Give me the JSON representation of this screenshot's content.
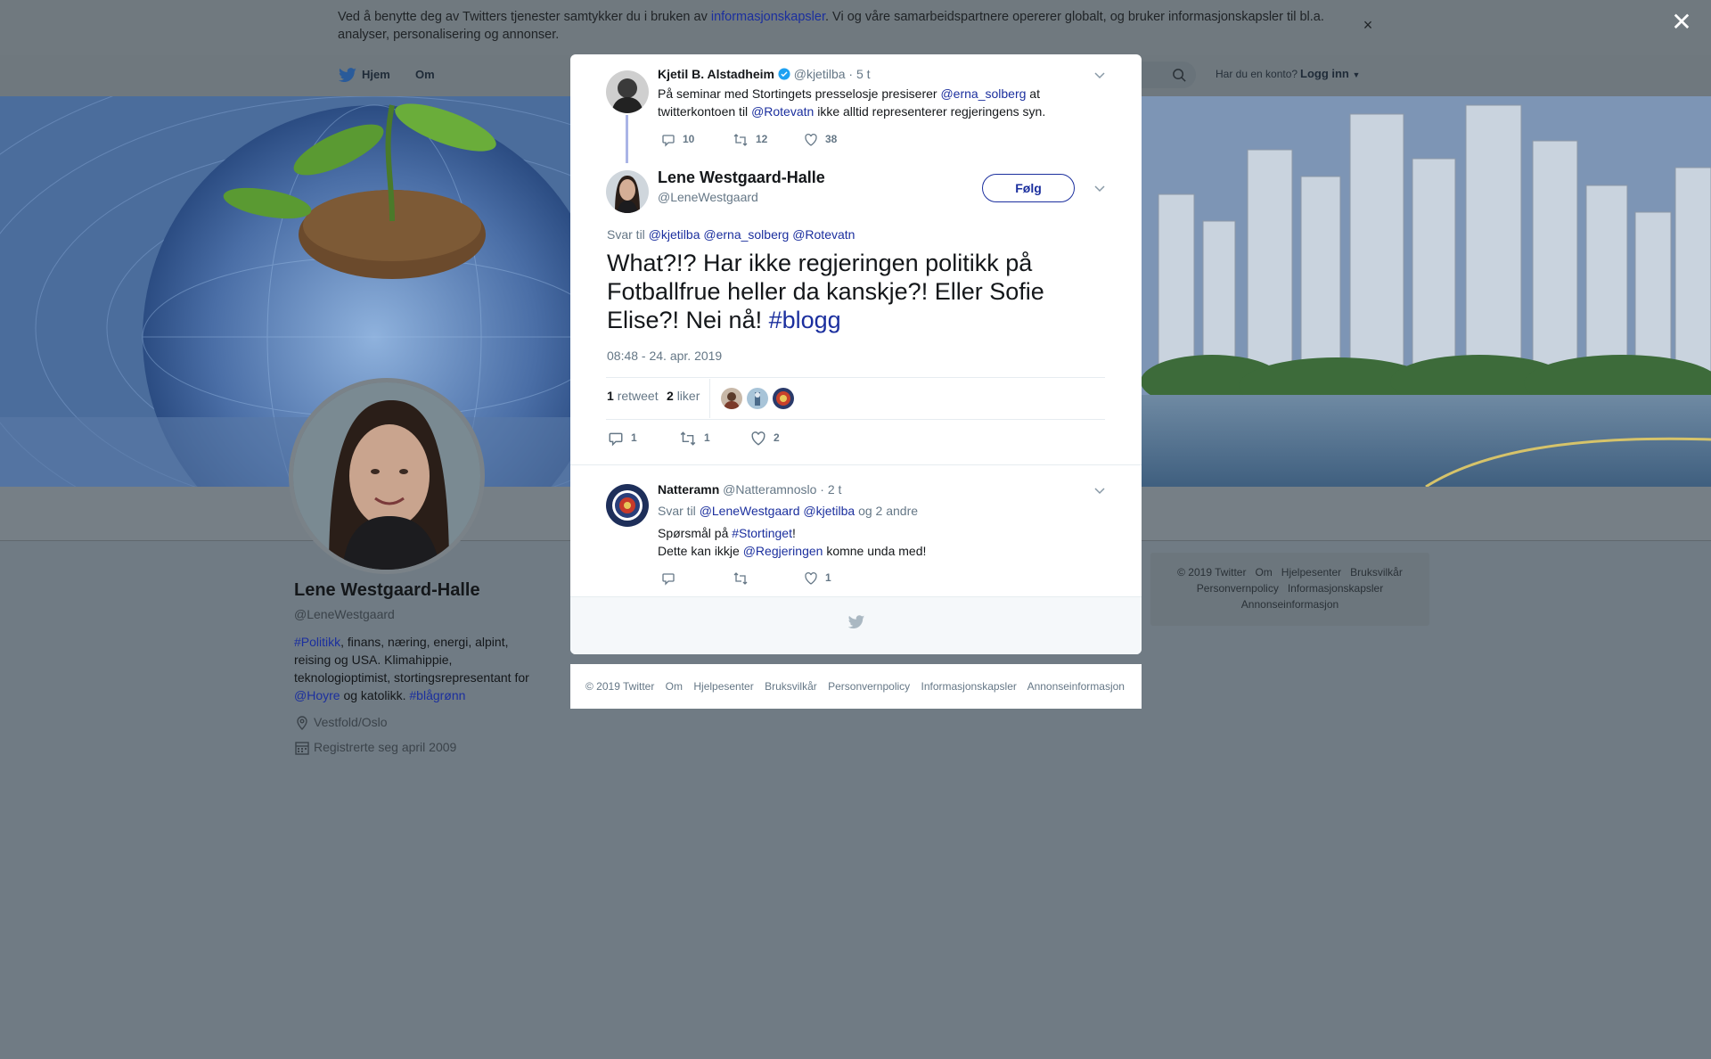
{
  "cookie": {
    "text_before": "Ved å benytte deg av Twitters tjenester samtykker du i bruken av ",
    "link": "informasjonskapsler",
    "text_after": ". Vi og våre samarbeidspartnere opererer globalt, og bruker informasjonskapsler til bl.a. analyser, personalisering og annonser.",
    "close": "×"
  },
  "overlay_close": "✕",
  "nav": {
    "home": "Hjem",
    "about": "Om",
    "login_question": "Har du en konto?",
    "login": "Logg inn"
  },
  "profile": {
    "name": "Lene Westgaard-Halle",
    "handle": "@LeneWestgaard",
    "bio_hashtag1": "#Politikk",
    "bio_text1": ", finans, næring, energi, alpint, reising og USA. Klimahippie, teknologioptimist, stortingsrepresentant for ",
    "bio_mention": "@Hoyre",
    "bio_text2": " og katolikk. ",
    "bio_hashtag2": "#blågrønn",
    "location": "Vestfold/Oslo",
    "joined": "Registrerte seg april 2009"
  },
  "right_footer": {
    "items": [
      "© 2019 Twitter",
      "Om",
      "Hjelpesenter",
      "Bruksvilkår",
      "Personvernpolicy",
      "Informasjonskapsler",
      "Annonseinformasjon"
    ]
  },
  "parent_tweet": {
    "name": "Kjetil B. Alstadheim",
    "handle": "@kjetilba",
    "time": "· 5 t",
    "text_before": "På seminar med Stortingets presselosje presiserer ",
    "mention1": "@erna_solberg",
    "text_mid": " at twitterkontoen til ",
    "mention2": "@Rotevatn",
    "text_after": " ikke alltid representerer regjeringens syn.",
    "replies": "10",
    "retweets": "12",
    "likes": "38"
  },
  "main_tweet": {
    "name": "Lene Westgaard-Halle",
    "handle": "@LeneWestgaard",
    "follow": "Følg",
    "reply_to_label": "Svar til",
    "reply_to": [
      "@kjetilba",
      "@erna_solberg",
      "@Rotevatn"
    ],
    "text": "What?!? Har ikke regjeringen politikk på Fotballfrue heller da kanskje?! Eller Sofie Elise?! Nei nå! ",
    "hashtag": "#blogg",
    "timestamp": "08:48 - 24. apr. 2019",
    "retweet_count": "1",
    "retweet_label": "retweet",
    "like_count": "2",
    "like_label": "liker",
    "replies": "1",
    "retweets": "1",
    "likes": "2"
  },
  "reply_tweet": {
    "name": "Natteramn",
    "handle": "@Natteramnoslo",
    "time": "· 2 t",
    "reply_to_label": "Svar til",
    "reply_to1": "@LeneWestgaard",
    "reply_to2": "@kjetilba",
    "reply_to_more": "og 2 andre",
    "line1_before": "Spørsmål på ",
    "line1_hashtag": "#Stortinget",
    "line1_after": "!",
    "line2_before": "Dette kan ikkje ",
    "line2_mention": "@Regjeringen",
    "line2_after": " komne unda med!",
    "likes": "1"
  },
  "modal_footer": {
    "items": [
      "© 2019 Twitter",
      "Om",
      "Hjelpesenter",
      "Bruksvilkår",
      "Personvernpolicy",
      "Informasjonskapsler",
      "Annonseinformasjon"
    ]
  },
  "colors": {
    "link": "#1b2f9e",
    "overlay": "#707b84",
    "verified": "#1da1f2"
  }
}
